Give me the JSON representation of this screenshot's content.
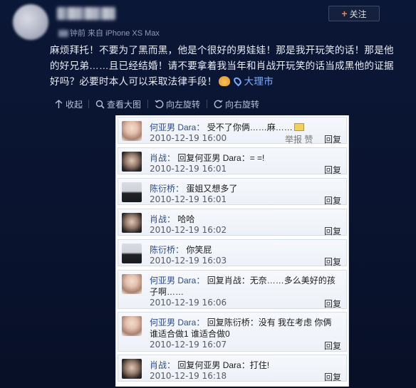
{
  "post": {
    "time_source": "钟前 来自 iPhone XS Max",
    "follow_label": "关注",
    "text_line1": "麻烦拜托！不要为了黑而黑，他是个很好的男娃娃！那是我开玩笑的话！那是他",
    "text_line2": "的好兄弟……且已经结婚！请不要拿着我当年和肖战开玩笑的话当成黑他的证据",
    "text_line3": "好吗？必要时本人可以采取法律手段！",
    "location": "大理市"
  },
  "toolbar": {
    "collapse": "收起",
    "view_large": "查看大图",
    "rotate_left": "向左旋转",
    "rotate_right": "向右旋转"
  },
  "comments": [
    {
      "name": "何亚男 Dara：",
      "text": "受不了你俩……麻……",
      "time": "2010-12-19 16:00",
      "extra": "举报  赞",
      "reply": "回复"
    },
    {
      "name": "肖战：",
      "text": "回复何亚男 Dara：= =!",
      "time": "2010-12-19 16:01",
      "reply": "回复"
    },
    {
      "name": "陈衍桥：",
      "text": "蛋姐又想多了",
      "time": "2010-12-19 16:01",
      "reply": "回复"
    },
    {
      "name": "肖战：",
      "text": "哈哈",
      "time": "2010-12-19 16:02",
      "reply": "回复"
    },
    {
      "name": "陈衍桥：",
      "text": "你笑屁",
      "time": "2010-12-19 16:03",
      "reply": "回复"
    },
    {
      "name": "何亚男 Dara：",
      "text": "回复肖战：无奈……多么美好的孩",
      "text2": "子啊……",
      "time": "2010-12-19 16:06",
      "reply": "回复"
    },
    {
      "name": "何亚男 Dara：",
      "text": "回复陈衍桥：没有 我在考虑 你俩",
      "text2": "谁适合做1 谁适合做0",
      "time": "2010-12-19 16:07",
      "reply": "回复"
    },
    {
      "name": "肖战：",
      "text": "回复何亚男 Dara：打住!",
      "time": "2010-12-19 16:18",
      "reply": "回复"
    }
  ],
  "colors": {
    "background": "#0a1430",
    "accent_location": "#7faeff",
    "follow_plus": "#ff7b43"
  }
}
